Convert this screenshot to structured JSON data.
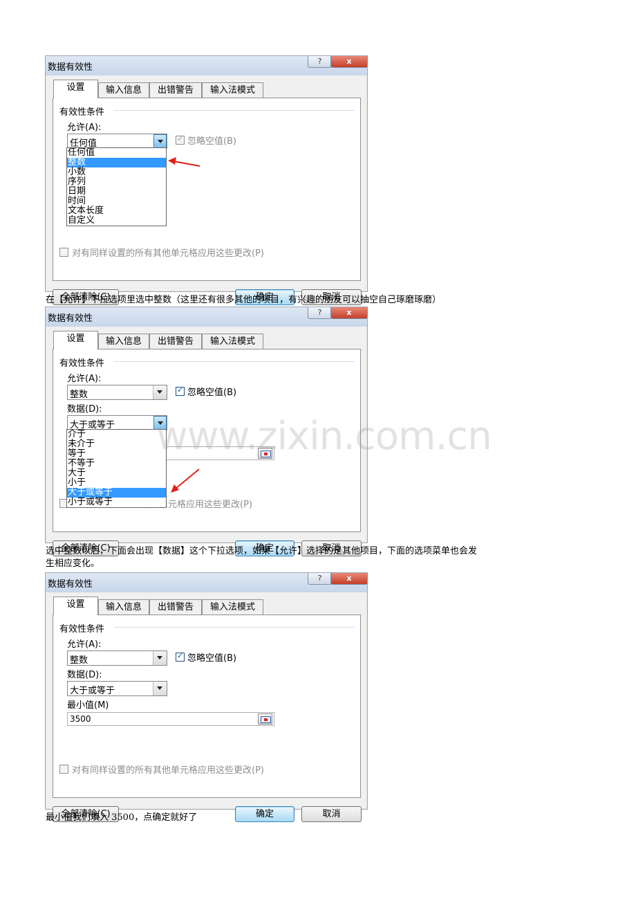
{
  "dialogs": [
    {
      "title": "数据有效性",
      "help_button": "?",
      "close_button": "x",
      "tabs": [
        "设置",
        "输入信息",
        "出错警告",
        "输入法模式"
      ],
      "group_label": "有效性条件",
      "allow_label": "允许(A):",
      "allow_value": "任何值",
      "ignore_blank_label": "忽略空值(B)",
      "dropdown_options": [
        "任何值",
        "整数",
        "小数",
        "序列",
        "日期",
        "时间",
        "文本长度",
        "自定义"
      ],
      "dropdown_selected": "整数",
      "apply_all_label": "对有同样设置的所有其他单元格应用这些更改(P)",
      "clear_all_button": "全部清除(C)",
      "ok_button": "确定",
      "cancel_button": "取消"
    },
    {
      "title": "数据有效性",
      "help_button": "?",
      "close_button": "x",
      "tabs": [
        "设置",
        "输入信息",
        "出错警告",
        "输入法模式"
      ],
      "group_label": "有效性条件",
      "allow_label": "允许(A):",
      "allow_value": "整数",
      "ignore_blank_label": "忽略空值(B)",
      "data_label": "数据(D):",
      "data_value": "大于或等于",
      "dropdown_options": [
        "介于",
        "未介于",
        "等于",
        "不等于",
        "大于",
        "小于",
        "大于或等于",
        "小于或等于"
      ],
      "dropdown_selected": "大于或等于",
      "apply_all_label_partial": "他单元格应用这些更改(P)",
      "clear_all_button": "全部清除(C)",
      "ok_button": "确定",
      "cancel_button": "取消"
    },
    {
      "title": "数据有效性",
      "help_button": "?",
      "close_button": "x",
      "tabs": [
        "设置",
        "输入信息",
        "出错警告",
        "输入法模式"
      ],
      "group_label": "有效性条件",
      "allow_label": "允许(A):",
      "allow_value": "整数",
      "ignore_blank_label": "忽略空值(B)",
      "data_label": "数据(D):",
      "data_value": "大于或等于",
      "min_label": "最小值(M)",
      "min_value": "3500",
      "apply_all_label": "对有同样设置的所有其他单元格应用这些更改(P)",
      "clear_all_button": "全部清除(C)",
      "ok_button": "确定",
      "cancel_button": "取消"
    }
  ],
  "captions": [
    "在【允许】下拉选项里选中整数（这里还有很多其他的项目，有兴趣的朋友可以抽空自己琢磨琢磨）",
    "选中整数以后，下面会出现【数据】这个下拉选项，如果【允许】选择的是其他项目，下面的选项菜单也会发",
    "生相应变化。",
    "最小值我们填入 3500，点确定就好了"
  ],
  "watermark": "www.zixin.com.cn",
  "colors": {
    "selection": "#3399ff",
    "arrow": "#e0201a",
    "close_button": "#c4402a"
  }
}
